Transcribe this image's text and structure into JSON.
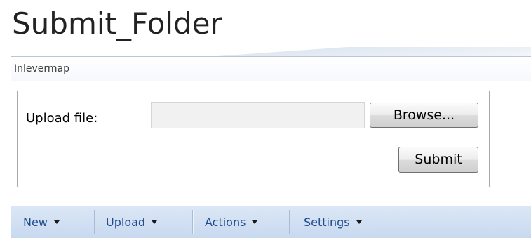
{
  "page": {
    "title": "Submit_Folder"
  },
  "subheader": {
    "label": "Inlevermap"
  },
  "upload": {
    "label": "Upload file:",
    "file_value": "",
    "browse_label": "Browse...",
    "submit_label": "Submit"
  },
  "toolbar": {
    "items": [
      {
        "label": "New",
        "icon": "chevron-down-icon"
      },
      {
        "label": "Upload",
        "icon": "chevron-down-icon"
      },
      {
        "label": "Actions",
        "icon": "chevron-down-icon"
      },
      {
        "label": "Settings",
        "icon": "chevron-down-icon"
      }
    ]
  },
  "colors": {
    "toolbar_text": "#1e4b8c",
    "toolbar_bg": "#d3e1f3",
    "border": "#a9a9a9"
  }
}
